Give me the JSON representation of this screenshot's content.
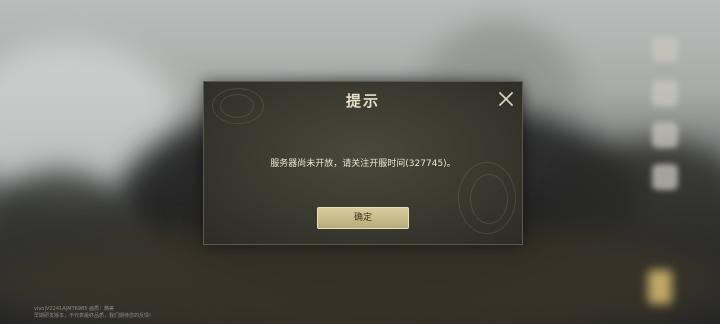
{
  "dialog": {
    "title": "提示",
    "message": "服务器尚未开放，请关注开服时间(327745)。",
    "confirm_label": "确定",
    "close_icon": "close-icon"
  },
  "build_info": {
    "line1": "vivo|V2241A|MT6985   画质：精美",
    "line2": "早期研发版本，不代表最终品质，我们期待您的反馈!"
  },
  "colors": {
    "dialog_bg": "#3a392f",
    "title_text": "#e6ddc4",
    "button_bg": "#c8bd8c"
  }
}
